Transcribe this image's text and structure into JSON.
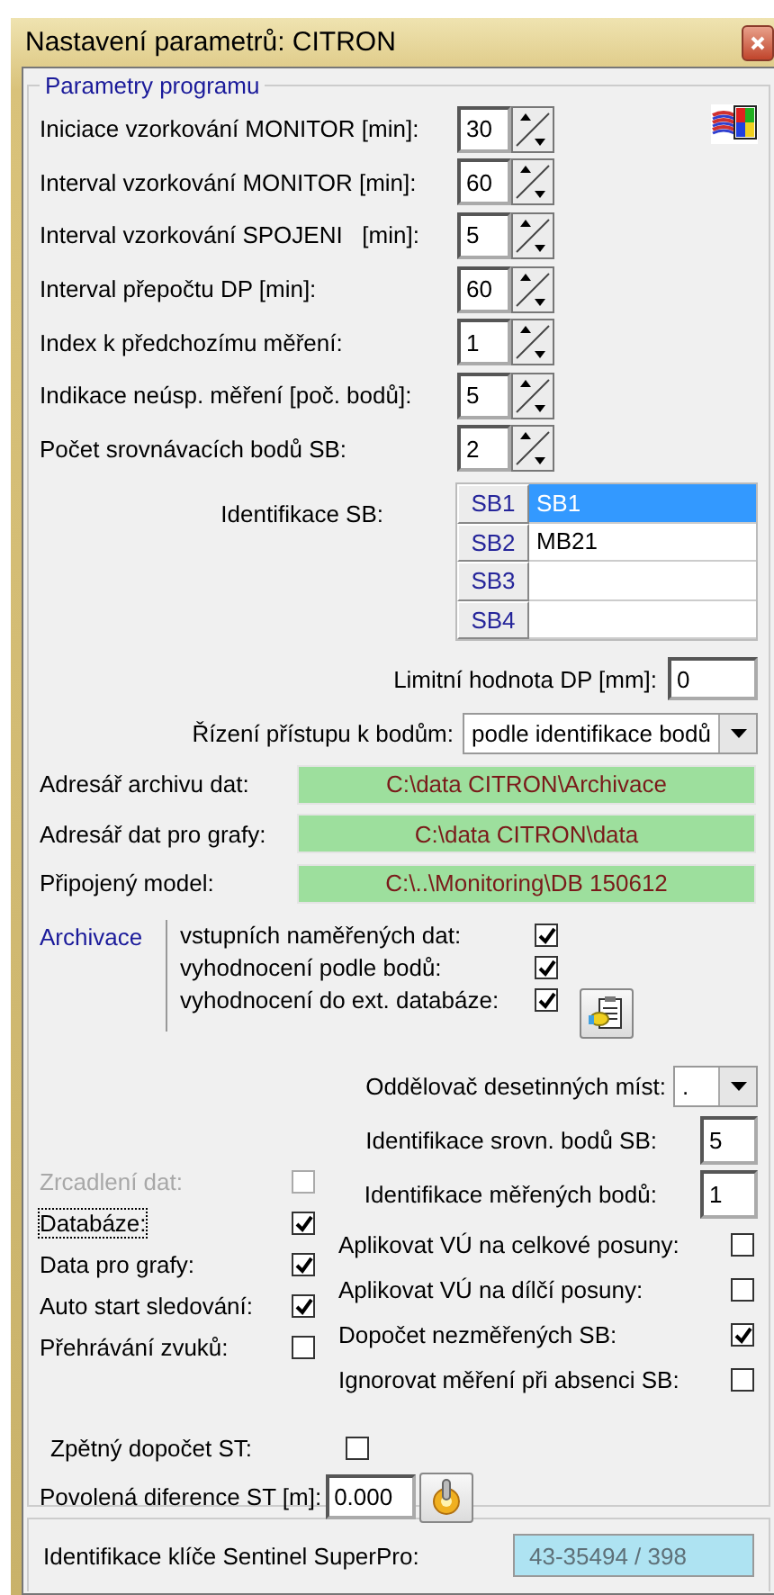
{
  "window": {
    "title": "Nastavení parametrů: CITRON"
  },
  "group": {
    "title": "Parametry programu"
  },
  "spinners": [
    {
      "label": "Iniciace vzorkování MONITOR [min]:",
      "value": "30"
    },
    {
      "label": "Interval vzorkování MONITOR [min]:",
      "value": "60"
    },
    {
      "label": "Interval vzorkování SPOJENI   [min]:",
      "value": "5"
    },
    {
      "label": "Interval přepočtu DP [min]:",
      "value": "60"
    },
    {
      "label": "Index k předchozímu měření:",
      "value": "1"
    },
    {
      "label": "Indikace neúsp. měření [poč. bodů]:",
      "value": "5"
    },
    {
      "label": "Počet srovnávacích bodů SB:",
      "value": "2"
    }
  ],
  "sb_table": {
    "label": "Identifikace SB:",
    "rows": [
      {
        "header": "SB1",
        "value": "SB1",
        "selected": true
      },
      {
        "header": "SB2",
        "value": "MB21",
        "selected": false
      },
      {
        "header": "SB3",
        "selected": false
      },
      {
        "header": "SB4",
        "selected": false
      }
    ]
  },
  "limit": {
    "label": "Limitní hodnota DP [mm]:",
    "value": "0"
  },
  "access": {
    "label": "Řízení přístupu k bodům:",
    "value": "podle identifikace bodů"
  },
  "paths": [
    {
      "label": "Adresář archivu dat:",
      "value": "C:\\data CITRON\\Archivace"
    },
    {
      "label": "Adresář dat pro grafy:",
      "value": "C:\\data CITRON\\data"
    },
    {
      "label": "Připojený model:",
      "value": "C:\\..\\Monitoring\\DB 150612"
    }
  ],
  "archive": {
    "label": "Archivace",
    "items": [
      {
        "label": "vstupních naměřených dat:",
        "checked": true
      },
      {
        "label": "vyhodnocení podle bodů:",
        "checked": true
      },
      {
        "label": "vyhodnocení do ext. databáze:",
        "checked": true
      }
    ]
  },
  "separator": {
    "label": "Oddělovač desetinných míst:",
    "value": "."
  },
  "id_fields": [
    {
      "label": "Identifikace srovn. bodů SB:",
      "value": "5"
    },
    {
      "label": "Identifikace měřených bodů:",
      "value": "1"
    }
  ],
  "left_options": [
    {
      "label": "Zrcadlení dat:",
      "checked": false,
      "disabled": true,
      "focused": false
    },
    {
      "label": "Databáze:",
      "checked": true,
      "disabled": false,
      "focused": true
    },
    {
      "label": "Data pro grafy:",
      "checked": true,
      "disabled": false,
      "focused": false
    },
    {
      "label": "Auto start sledování:",
      "checked": true,
      "disabled": false,
      "focused": false
    },
    {
      "label": "Přehrávání zvuků:",
      "checked": false,
      "disabled": false,
      "focused": false
    }
  ],
  "right_options": [
    {
      "label": "Aplikovat VÚ na celkové posuny:",
      "checked": false
    },
    {
      "label": "Aplikovat VÚ na dílčí posuny:",
      "checked": false
    },
    {
      "label": "Dopočet nezměřených SB:",
      "checked": true
    },
    {
      "label": "Ignorovat měření při absenci SB:",
      "checked": false
    }
  ],
  "back_calc": {
    "label": "Zpětný dopočet ST:",
    "checked": false
  },
  "allowed_diff": {
    "label": "Povolená diference ST [m]:",
    "value": "0.000"
  },
  "key": {
    "label": "Identifikace klíče Sentinel SuperPro:",
    "value": "43-35494 / 398"
  }
}
